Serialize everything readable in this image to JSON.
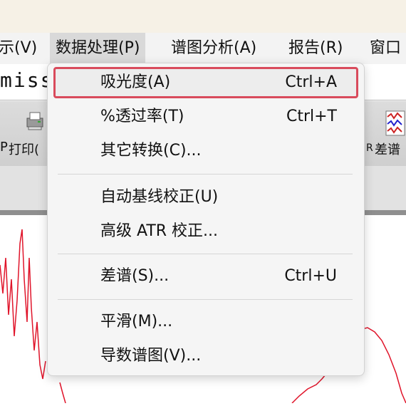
{
  "menubar": {
    "items": [
      {
        "label": "示(V)"
      },
      {
        "label": "数据处理(P)"
      },
      {
        "label": "谱图分析(A)"
      },
      {
        "label": "报告(R)"
      },
      {
        "label": "窗口"
      }
    ]
  },
  "field": {
    "text": "miss"
  },
  "toolbar": {
    "print_label": "打印(",
    "diff_label": "差谱",
    "left_fragment": "P",
    "diff_prefix": "R"
  },
  "dropdown": {
    "items": [
      {
        "label": "吸光度(A)",
        "shortcut": "Ctrl+A"
      },
      {
        "label": "%透过率(T)",
        "shortcut": "Ctrl+T"
      },
      {
        "label": "其它转换(C)...",
        "shortcut": ""
      },
      {
        "label": "自动基线校正(U)",
        "shortcut": ""
      },
      {
        "label": "高级 ATR 校正...",
        "shortcut": ""
      },
      {
        "label": "差谱(S)...",
        "shortcut": "Ctrl+U"
      },
      {
        "label": "平滑(M)...",
        "shortcut": ""
      },
      {
        "label": "导数谱图(V)...",
        "shortcut": ""
      }
    ]
  },
  "colors": {
    "spectrum_line": "#e0142a",
    "selection_border": "#d94b5c"
  }
}
